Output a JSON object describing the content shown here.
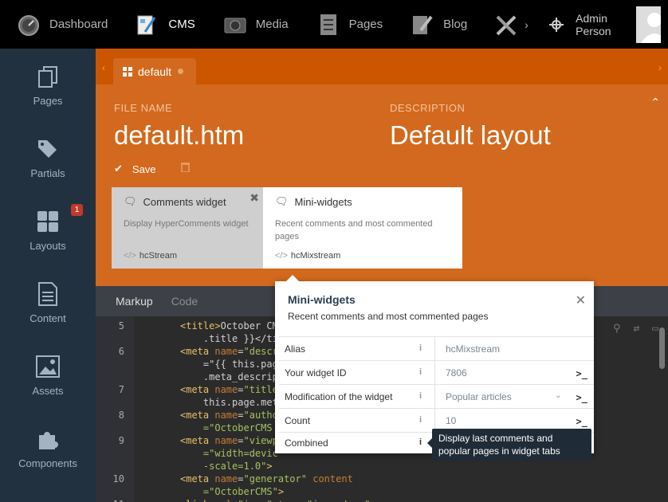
{
  "topnav": {
    "items": [
      {
        "label": "Dashboard",
        "icon": "dashboard-gauge-icon"
      },
      {
        "label": "CMS",
        "icon": "cms-editor-icon"
      },
      {
        "label": "Media",
        "icon": "media-camera-icon"
      },
      {
        "label": "Pages",
        "icon": "pages-checklist-icon"
      },
      {
        "label": "Blog",
        "icon": "blog-pencil-icon"
      }
    ],
    "more": "›",
    "user": "Admin Person"
  },
  "sidebar": {
    "items": [
      {
        "label": "Pages",
        "icon": "pages-icon"
      },
      {
        "label": "Partials",
        "icon": "partials-tags-icon"
      },
      {
        "label": "Layouts",
        "icon": "layouts-grid-icon",
        "badge": "1"
      },
      {
        "label": "Content",
        "icon": "content-document-icon"
      },
      {
        "label": "Assets",
        "icon": "assets-image-icon"
      },
      {
        "label": "Components",
        "icon": "components-puzzle-icon"
      }
    ]
  },
  "tabs": {
    "active": "default",
    "prev": "‹",
    "next": "›"
  },
  "form": {
    "file_name_label": "FILE NAME",
    "file_name": "default.htm",
    "description_label": "DESCRIPTION",
    "description": "Default layout",
    "save": "Save"
  },
  "widgets": [
    {
      "title": "Comments widget",
      "desc": "Display HyperComments widget",
      "code": "hcStream"
    },
    {
      "title": "Mini-widgets",
      "desc": "Recent comments and most commented pages",
      "code": "hcMixstream"
    }
  ],
  "editor": {
    "tabs": [
      "Markup",
      "Code"
    ],
    "lines": [
      {
        "n": "5",
        "parts": [
          [
            "tag",
            "<title>"
          ],
          [
            "txt",
            "October CM"
          ]
        ]
      },
      {
        "n": "",
        "parts": [
          [
            "txt",
            "    .title }}</ti"
          ]
        ]
      },
      {
        "n": "6",
        "parts": [
          [
            "tag",
            "<meta "
          ],
          [
            "att",
            "name"
          ],
          [
            "txt",
            "="
          ],
          [
            "str",
            "\"descr"
          ]
        ]
      },
      {
        "n": "",
        "parts": [
          [
            "txt",
            "    =\"{{ this.pag"
          ]
        ]
      },
      {
        "n": "",
        "parts": [
          [
            "txt",
            "    .meta_descrip"
          ]
        ]
      },
      {
        "n": "7",
        "parts": [
          [
            "tag",
            "<meta "
          ],
          [
            "att",
            "name"
          ],
          [
            "txt",
            "="
          ],
          [
            "str",
            "\"title"
          ]
        ]
      },
      {
        "n": "",
        "parts": [
          [
            "txt",
            "    this.page.met"
          ]
        ]
      },
      {
        "n": "8",
        "parts": [
          [
            "tag",
            "<meta "
          ],
          [
            "att",
            "name"
          ],
          [
            "txt",
            "="
          ],
          [
            "str",
            "\"autho"
          ]
        ]
      },
      {
        "n": "",
        "parts": [
          [
            "str",
            "    =\"OctoberCMS"
          ]
        ]
      },
      {
        "n": "9",
        "parts": [
          [
            "tag",
            "<meta "
          ],
          [
            "att",
            "name"
          ],
          [
            "txt",
            "="
          ],
          [
            "str",
            "\"viewp"
          ]
        ]
      },
      {
        "n": "",
        "parts": [
          [
            "str",
            "    =\"width=devic"
          ]
        ]
      },
      {
        "n": "",
        "parts": [
          [
            "str",
            "    -scale=1.0\""
          ],
          [
            "tag",
            ">"
          ]
        ]
      },
      {
        "n": "10",
        "parts": [
          [
            "tag",
            "<meta "
          ],
          [
            "att",
            "name"
          ],
          [
            "txt",
            "="
          ],
          [
            "str",
            "\"generator\""
          ],
          [
            "txt",
            " "
          ],
          [
            "att",
            "content"
          ]
        ]
      },
      {
        "n": "",
        "parts": [
          [
            "str",
            "    =\"OctoberCMS\""
          ],
          [
            "tag",
            ">"
          ]
        ]
      },
      {
        "n": "11",
        "parts": [
          [
            "tag",
            "<link "
          ],
          [
            "att",
            "rel"
          ],
          [
            "txt",
            "="
          ],
          [
            "str",
            "\"icon\""
          ],
          [
            "txt",
            " "
          ],
          [
            "att",
            "type"
          ],
          [
            "txt",
            "="
          ],
          [
            "str",
            "\"image/png\""
          ]
        ]
      }
    ]
  },
  "popover": {
    "title": "Mini-widgets",
    "subtitle": "Recent comments and most commented pages",
    "rows": [
      {
        "key": "Alias",
        "value": "hcMixstream",
        "button": ""
      },
      {
        "key": "Your widget ID",
        "value": "7806",
        "button": ">_"
      },
      {
        "key": "Modification of the widget",
        "value": "Popular articles",
        "button": ">_",
        "dropdown": true
      },
      {
        "key": "Count",
        "value": "10",
        "button": ">_"
      },
      {
        "key": "Combined",
        "value": "",
        "button": ""
      }
    ],
    "tooltip": "Display last comments and popular pages in widget tabs"
  }
}
